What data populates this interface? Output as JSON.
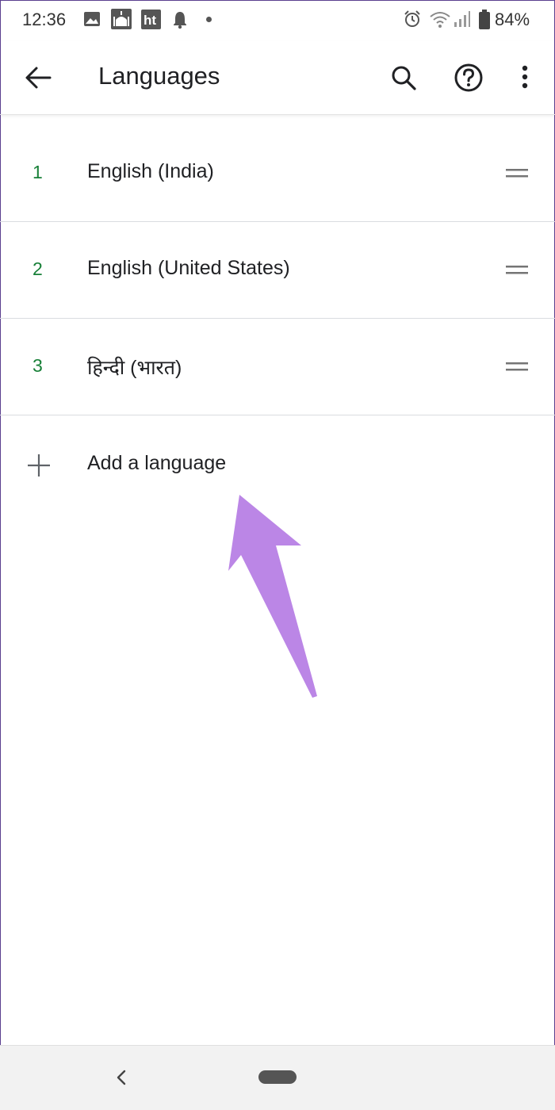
{
  "status_bar": {
    "time": "12:36",
    "battery_percent": "84%",
    "icons": [
      "image-icon",
      "mosque-app-icon",
      "ht-app-icon",
      "bell-icon",
      "dot-icon",
      "alarm-icon",
      "wifi-icon",
      "signal-icon",
      "battery-icon"
    ]
  },
  "app_bar": {
    "title": "Languages",
    "icons": [
      "back-arrow-icon",
      "search-icon",
      "help-icon",
      "more-vert-icon"
    ]
  },
  "languages": [
    {
      "rank": "1",
      "name": "English (India)"
    },
    {
      "rank": "2",
      "name": "English (United States)"
    },
    {
      "rank": "3",
      "name": "हिन्दी (भारत)"
    }
  ],
  "add_language": {
    "label": "Add a language",
    "icon": "plus-icon"
  },
  "annotation": {
    "type": "arrow",
    "color": "#bb86e6",
    "points_to": "Add a language"
  },
  "colors": {
    "rank_number": "#188038",
    "text": "#202124",
    "divider": "#dadce0"
  },
  "nav_bar": {
    "icons": [
      "nav-back-icon",
      "home-pill-icon"
    ]
  }
}
